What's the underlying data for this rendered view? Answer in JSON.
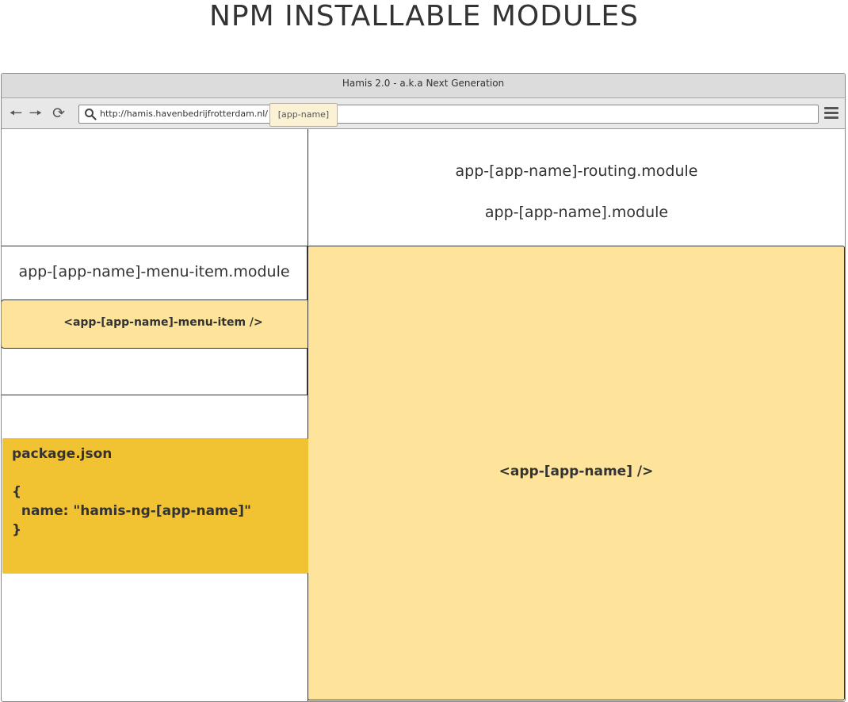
{
  "page": {
    "title": "NPM INSTALLABLE MODULES"
  },
  "browser": {
    "window_title": "Hamis 2.0 - a.k.a Next Generation",
    "url_base": "http://hamis.havenbedrijfrotterdam.nl/",
    "url_highlight": "[app-name]",
    "icons": {
      "back": "arrow-left-icon",
      "forward": "arrow-right-icon",
      "reload": "reload-icon",
      "search": "search-icon",
      "menu": "hamburger-menu-icon"
    }
  },
  "modules": {
    "routing": "app-[app-name]-routing.module",
    "app": "app-[app-name].module",
    "menu_item": "app-[app-name]-menu-item.module"
  },
  "components": {
    "menu_item": "<app-[app-name]-menu-item />",
    "app": "<app-[app-name] />"
  },
  "package": {
    "filename": "package.json",
    "open_brace": "{",
    "name_line": "  name: \"hamis-ng-[app-name]\"",
    "close_brace": "}"
  },
  "colors": {
    "component_fill": "#fde49a",
    "package_fill": "#f1c232",
    "titlebar": "#dcdcdc",
    "border": "#333333"
  }
}
